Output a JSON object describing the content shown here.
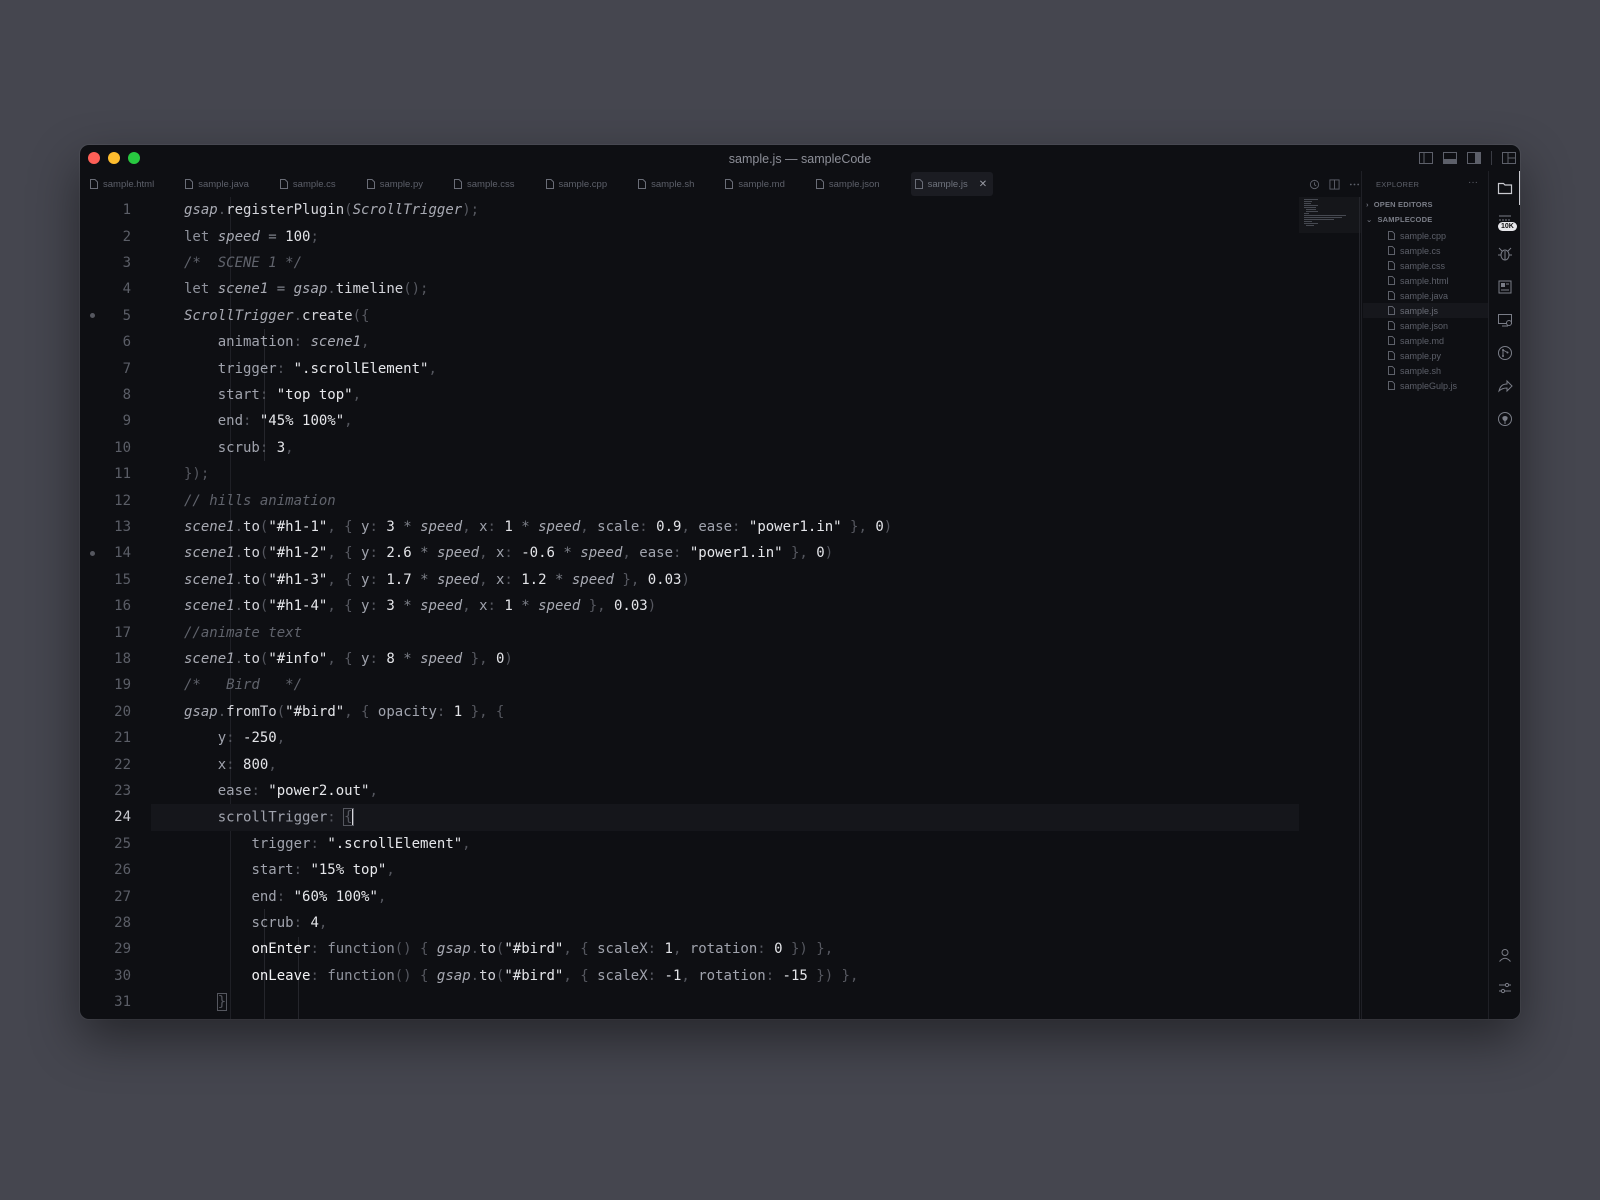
{
  "window": {
    "title": "sample.js — sampleCode"
  },
  "tabs": [
    {
      "label": "sample.html"
    },
    {
      "label": "sample.java"
    },
    {
      "label": "sample.cs"
    },
    {
      "label": "sample.py"
    },
    {
      "label": "sample.css"
    },
    {
      "label": "sample.cpp"
    },
    {
      "label": "sample.sh"
    },
    {
      "label": "sample.md"
    },
    {
      "label": "sample.json"
    },
    {
      "label": "sample.js",
      "active": true
    }
  ],
  "editor": {
    "current_line": 24,
    "breakpoints": [
      5,
      14
    ],
    "line_numbers": [
      "1",
      "2",
      "3",
      "4",
      "5",
      "6",
      "7",
      "8",
      "9",
      "10",
      "11",
      "12",
      "13",
      "14",
      "15",
      "16",
      "17",
      "18",
      "19",
      "20",
      "21",
      "22",
      "23",
      "24",
      "25",
      "26",
      "27",
      "28",
      "29",
      "30",
      "31"
    ]
  },
  "explorer": {
    "title": "EXPLORER",
    "more_label": "···",
    "open_editors_label": "OPEN EDITORS",
    "folder_label": "SAMPLECODE",
    "files": [
      "sample.cpp",
      "sample.cs",
      "sample.css",
      "sample.html",
      "sample.java",
      "sample.js",
      "sample.json",
      "sample.md",
      "sample.py",
      "sample.sh",
      "sampleGulp.js"
    ],
    "selected_file": "sample.js"
  },
  "activity_bar": {
    "icons": [
      "files-icon",
      "lines-icon",
      "bug-icon",
      "image-icon",
      "remote-icon",
      "git-icon",
      "share-icon",
      "github-icon",
      "account-icon",
      "settings-icon"
    ],
    "badge": "10K"
  },
  "colors": {
    "background": "#45464f",
    "editor_bg": "#0e0f13",
    "close_light": "#fe5f57",
    "minimize_light": "#febc2e",
    "zoom_light": "#28c840"
  }
}
